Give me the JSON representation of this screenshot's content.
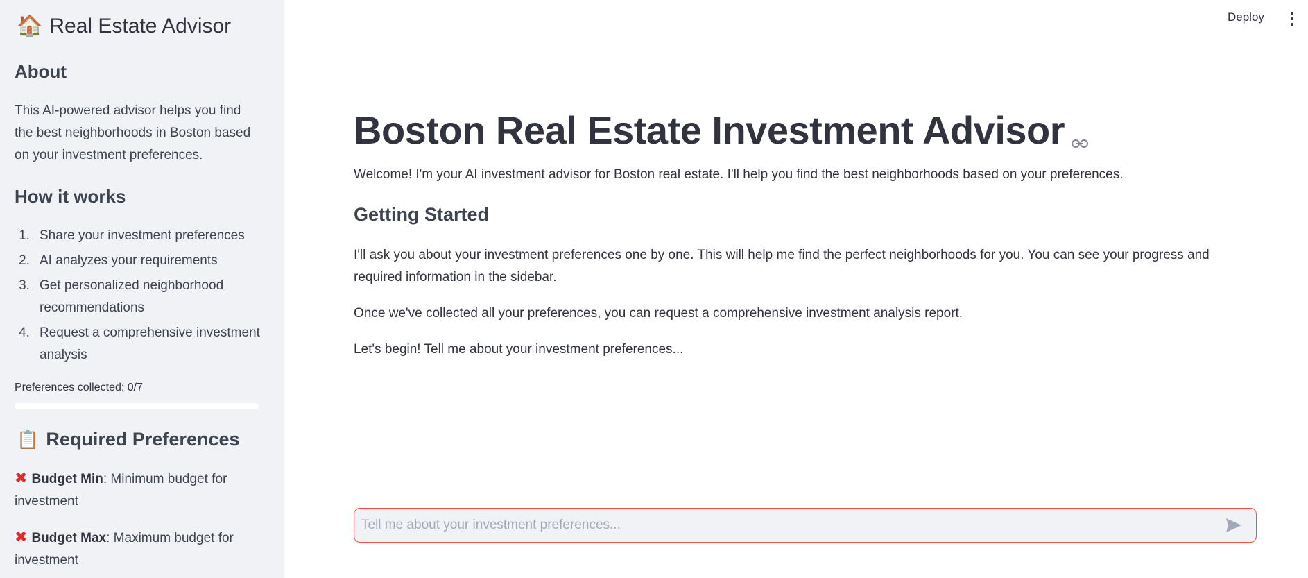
{
  "sidebar": {
    "title_emoji": "🏠",
    "title": "Real Estate Advisor",
    "about_heading": "About",
    "about_text": "This AI-powered advisor helps you find the best neighborhoods in Boston based on your investment preferences.",
    "how_heading": "How it works",
    "steps": [
      {
        "num": "1.",
        "text": "Share your investment preferences"
      },
      {
        "num": "2.",
        "text": "AI analyzes your requirements"
      },
      {
        "num": "3.",
        "text": "Get personalized neighborhood recommendations"
      },
      {
        "num": "4.",
        "text": "Request a comprehensive investment analysis"
      }
    ],
    "progress_label": "Preferences collected: 0/7",
    "progress_fraction": 0,
    "required_emoji": "📋",
    "required_heading": "Required Preferences",
    "preferences": [
      {
        "status": "✖",
        "name": "Budget Min",
        "desc": ": Minimum budget for investment"
      },
      {
        "status": "✖",
        "name": "Budget Max",
        "desc": ": Maximum budget for investment"
      }
    ]
  },
  "header": {
    "deploy_label": "Deploy"
  },
  "main": {
    "title": "Boston Real Estate Investment Advisor",
    "welcome": "Welcome! I'm your AI investment advisor for Boston real estate. I'll help you find the best neighborhoods based on your preferences.",
    "getting_started_heading": "Getting Started",
    "para1": "I'll ask you about your investment preferences one by one. This will help me find the perfect neighborhoods for you. You can see your progress and required information in the sidebar.",
    "para2": "Once we've collected all your preferences, you can request a comprehensive investment analysis report.",
    "para3": "Let's begin! Tell me about your investment preferences..."
  },
  "chat": {
    "value": "",
    "placeholder": "Tell me about your investment preferences..."
  },
  "colors": {
    "accent": "#ff4b4b",
    "sidebar_bg": "#f0f2f6",
    "text": "#31333f",
    "error_x": "#e0282e"
  }
}
